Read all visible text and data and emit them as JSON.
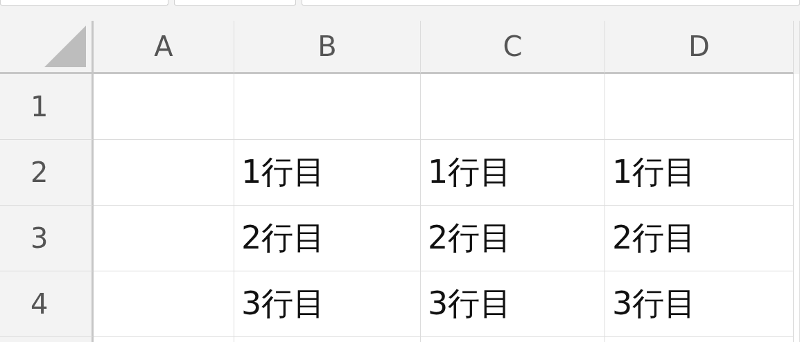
{
  "sheet": {
    "columns": [
      "A",
      "B",
      "C",
      "D"
    ],
    "rows": [
      {
        "header": "1",
        "cells": [
          null,
          null,
          null,
          null
        ]
      },
      {
        "header": "2",
        "cells": [
          null,
          "1行目",
          "1行目",
          "1行目"
        ]
      },
      {
        "header": "3",
        "cells": [
          null,
          "2行目",
          "2行目",
          "2行目"
        ]
      },
      {
        "header": "4",
        "cells": [
          null,
          "3行目",
          "3行目",
          "3行目"
        ]
      }
    ]
  }
}
